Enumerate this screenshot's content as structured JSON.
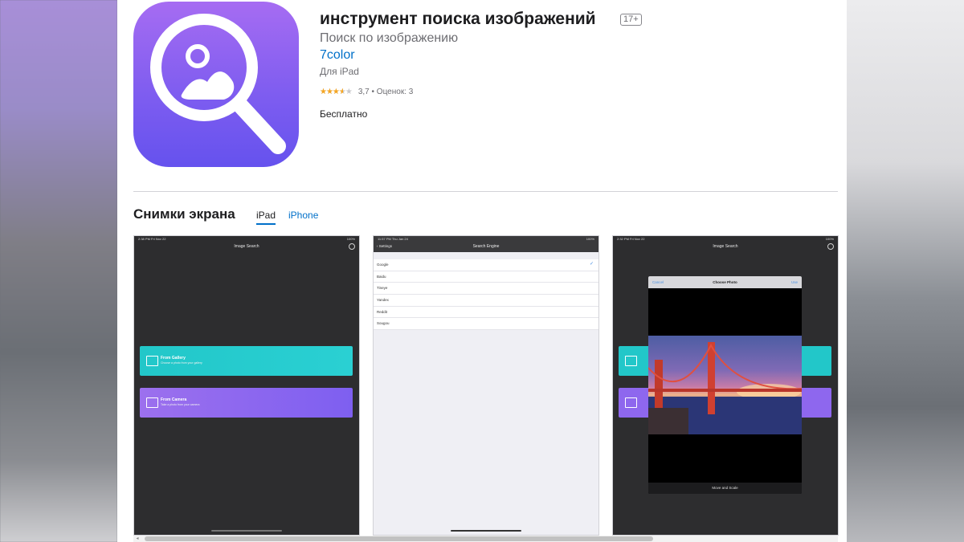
{
  "app": {
    "title": "инструмент поиска изображений",
    "age_rating": "17+",
    "subtitle": "Поиск по изображению",
    "developer": "7color",
    "platform": "Для iPad",
    "rating": {
      "stars": 3.7,
      "text": "3,7 • Оценок: 3"
    },
    "price": "Бесплатно",
    "icon": "magnifier-image-icon",
    "accent_color": "#7f5df0"
  },
  "screenshots_section": {
    "title": "Снимки экрана",
    "tabs": [
      {
        "label": "iPad",
        "active": true
      },
      {
        "label": "iPhone",
        "active": false
      }
    ]
  },
  "screens": {
    "home": {
      "status_left": "2:38 PM   Fri Nov 22",
      "status_right": "100%",
      "title": "Image Search",
      "gallery_title": "From Gallery",
      "gallery_sub": "Choose a photo from your gallery",
      "camera_title": "From Camera",
      "camera_sub": "Take a photo from your camera"
    },
    "settings": {
      "status_left": "11:57 PM   Thu Jan 24",
      "status_right": "100%",
      "back": "Settings",
      "title": "Search Engine",
      "engines": [
        "Google",
        "Baidu",
        "Tineye",
        "Yandex",
        "Reddit",
        "Sougou"
      ],
      "selected": "Google"
    },
    "picker": {
      "status_left": "2:32 PM   Fri Nov 22",
      "status_right": "100%",
      "title": "Image Search",
      "cancel": "Cancel",
      "modal_title": "Choose Photo",
      "use": "Use",
      "footer": "Move and Scale"
    }
  }
}
